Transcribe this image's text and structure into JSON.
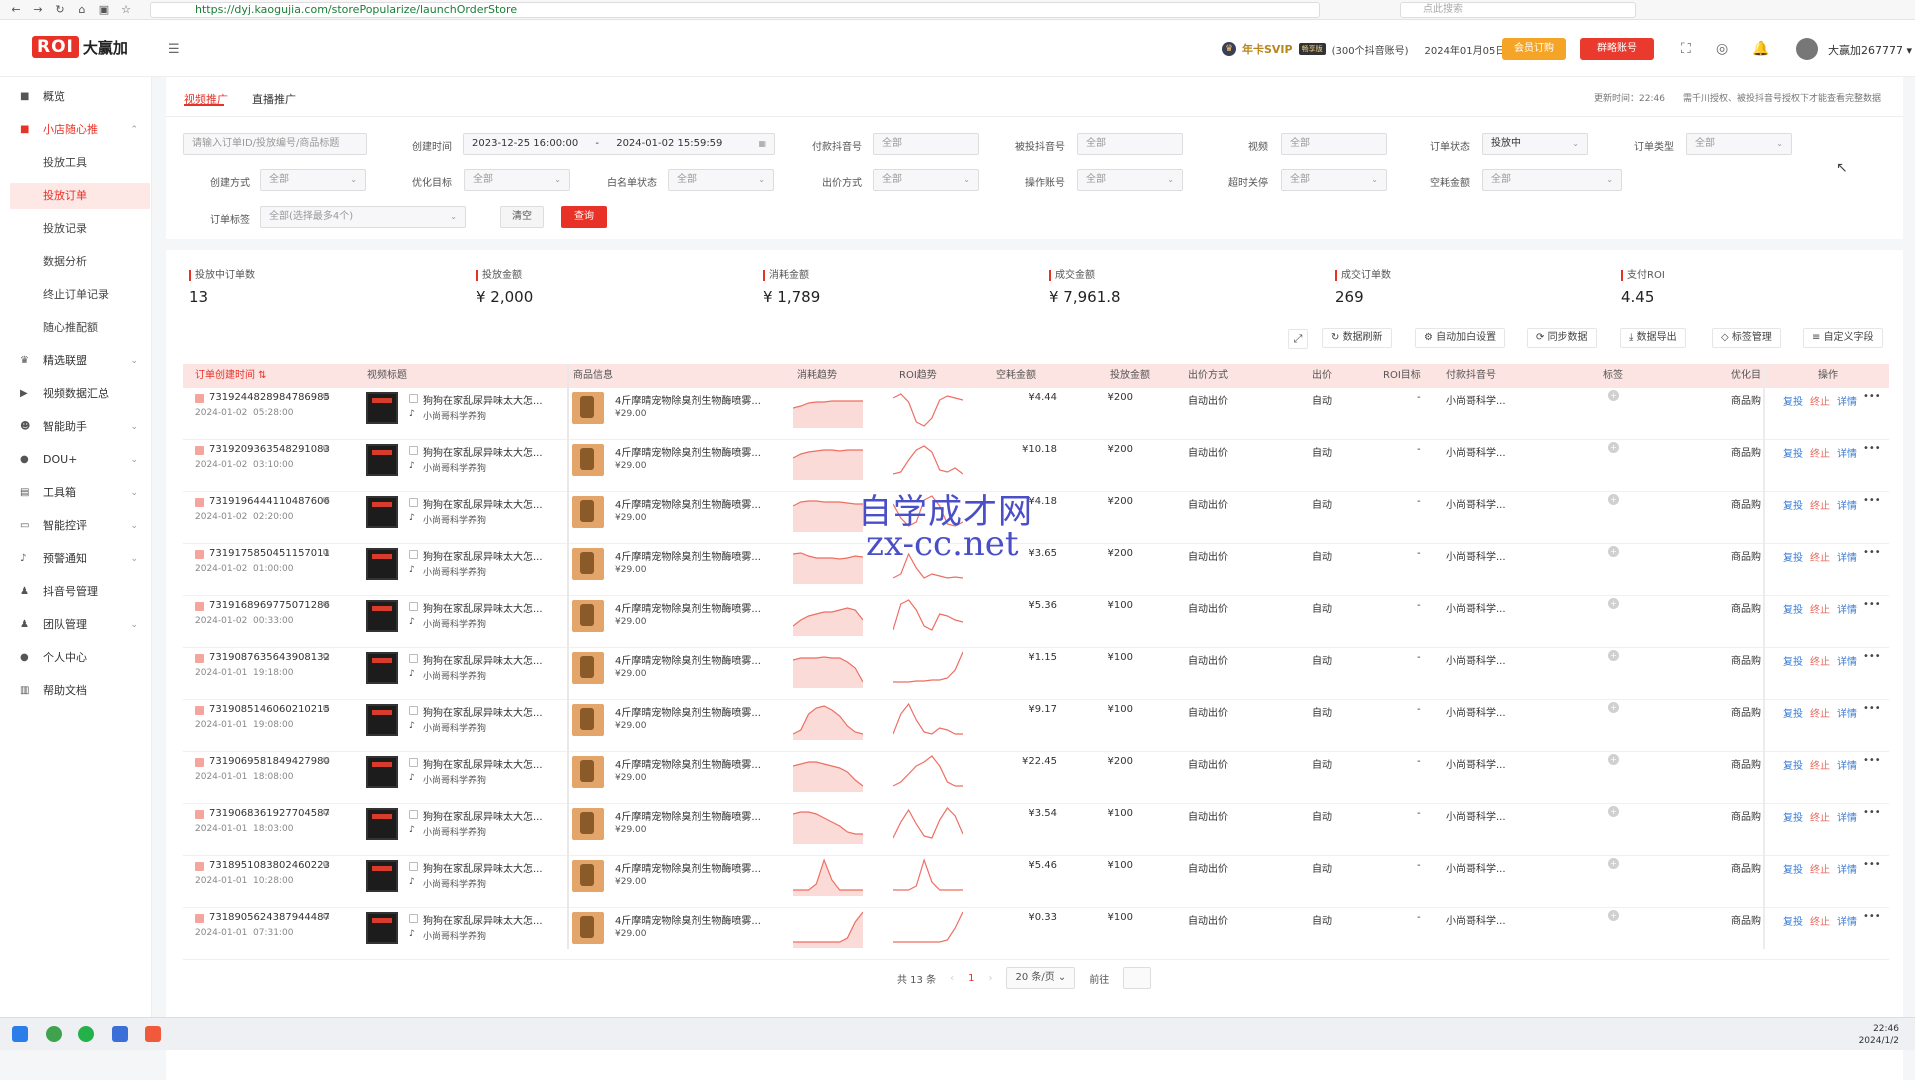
{
  "browser": {
    "url": "https://dyj.kaogujia.com/storePopularize/launchOrderStore",
    "search_placeholder": "点此搜索"
  },
  "header": {
    "logo_text": "ROI",
    "brand_name": "大赢加",
    "svip_label": "年卡SVIP",
    "svip_badge": "畅享版",
    "svip_accounts": "(300个抖音账号)",
    "expire": "2024年01月05日到期",
    "member_button": "会员订购",
    "bind_button": "群略账号",
    "username": "大赢加267777"
  },
  "sidebar": {
    "items": [
      {
        "label": "概览"
      },
      {
        "label": "小店随心推"
      },
      {
        "label": "投放工具"
      },
      {
        "label": "投放订单"
      },
      {
        "label": "投放记录"
      },
      {
        "label": "数据分析"
      },
      {
        "label": "终止订单记录"
      },
      {
        "label": "随心推配额"
      },
      {
        "label": "精选联盟"
      },
      {
        "label": "视频数据汇总"
      },
      {
        "label": "智能助手"
      },
      {
        "label": "DOU+"
      },
      {
        "label": "工具箱"
      },
      {
        "label": "智能控评"
      },
      {
        "label": "预警通知"
      },
      {
        "label": "抖音号管理"
      },
      {
        "label": "团队管理"
      },
      {
        "label": "个人中心"
      },
      {
        "label": "帮助文档"
      }
    ]
  },
  "tabs": [
    {
      "label": "视频推广"
    },
    {
      "label": "直播推广"
    }
  ],
  "update_note": "更新时间：22:46　　需千川授权、被投抖音号授权下才能查看完整数据",
  "filters": {
    "search_placeholder": "请输入订单ID/投放编号/商品标题",
    "created_time_label": "创建时间",
    "date_start": "2023-12-25 16:00:00",
    "date_sep": "-",
    "date_end": "2024-01-02 15:59:59",
    "pay_account_label": "付款抖音号",
    "target_account_label": "被投抖音号",
    "video_label": "视频",
    "order_status_label": "订单状态",
    "order_status_value": "投放中",
    "order_type_label": "订单类型",
    "create_method_label": "创建方式",
    "optimize_label": "优化目标",
    "whitelist_label": "白名单状态",
    "bid_label": "出价方式",
    "operator_label": "操作账号",
    "timeout_label": "超时关停",
    "empty_cost_label": "空耗金额",
    "order_tag_label": "订单标签",
    "tag_placeholder": "全部(选择最多4个)",
    "all": "全部",
    "clear_button": "清空",
    "query_button": "查询"
  },
  "stats": [
    {
      "label": "投放中订单数",
      "value": "13"
    },
    {
      "label": "投放金额",
      "value": "¥ 2,000"
    },
    {
      "label": "消耗金额",
      "value": "¥ 1,789"
    },
    {
      "label": "成交金额",
      "value": "¥ 7,961.8"
    },
    {
      "label": "成交订单数",
      "value": "269"
    },
    {
      "label": "支付ROI",
      "value": "4.45"
    }
  ],
  "toolbar": {
    "refresh": "数据刷新",
    "auto_whitelist": "自动加白设置",
    "sync": "同步数据",
    "export": "数据导出",
    "tag_manage": "标签管理",
    "custom_fields": "自定义字段"
  },
  "table": {
    "headers": [
      "订单创建时间",
      "视频标题",
      "商品信息",
      "消耗趋势",
      "ROI趋势",
      "空耗金额",
      "投放金额",
      "出价方式",
      "出价",
      "ROI目标",
      "付款抖音号",
      "标签",
      "优化目",
      "操作"
    ],
    "video_title": "狗狗在家乱尿异味太大怎...",
    "video_author": "小尚哥科学养狗",
    "product_title": "4斤摩晴宠物除臭剂生物酶喷雾...",
    "product_price": "¥29.00",
    "bid_method": "自动出价",
    "bid": "自动",
    "roi_target": "-",
    "pay_account": "小尚哥科学...",
    "optimize": "商品购",
    "ops": [
      "复投",
      "终止",
      "详情"
    ],
    "rows": [
      {
        "order_id": "7319244828984786985",
        "date": "2024-01-02",
        "time": "05:28:00",
        "empty_cost": "¥4.44",
        "amount": "¥200",
        "trend": [
          20,
          18,
          15,
          14,
          14,
          13,
          13,
          13,
          13,
          13
        ],
        "roi": [
          10,
          6,
          14,
          34,
          38,
          30,
          12,
          8,
          10,
          12
        ]
      },
      {
        "order_id": "7319209363548291083",
        "date": "2024-01-02",
        "time": "03:10:00",
        "empty_cost": "¥10.18",
        "amount": "¥200",
        "trend": [
          18,
          14,
          12,
          11,
          10,
          10,
          11,
          10,
          10,
          10
        ],
        "roi": [
          34,
          32,
          20,
          10,
          6,
          12,
          30,
          32,
          28,
          34
        ]
      },
      {
        "order_id": "7319196444110487606",
        "date": "2024-01-02",
        "time": "02:20:00",
        "empty_cost": "¥4.18",
        "amount": "¥200",
        "trend": [
          14,
          10,
          9,
          9,
          10,
          10,
          10,
          11,
          12,
          12
        ],
        "roi": [
          12,
          26,
          34,
          30,
          8,
          4,
          14,
          32,
          34,
          30
        ]
      },
      {
        "order_id": "7319175850451157011",
        "date": "2024-01-02",
        "time": "01:00:00",
        "empty_cost": "¥3.65",
        "amount": "¥200",
        "trend": [
          10,
          9,
          12,
          14,
          14,
          14,
          15,
          14,
          12,
          13
        ],
        "roi": [
          34,
          30,
          10,
          24,
          34,
          30,
          32,
          34,
          33,
          34
        ]
      },
      {
        "order_id": "7319168969775071286",
        "date": "2024-01-02",
        "time": "00:33:00",
        "empty_cost": "¥5.36",
        "amount": "¥100",
        "trend": [
          30,
          24,
          20,
          18,
          16,
          16,
          14,
          12,
          14,
          24
        ],
        "roi": [
          34,
          8,
          4,
          14,
          30,
          34,
          18,
          20,
          24,
          26
        ]
      },
      {
        "order_id": "7319087635643908132",
        "date": "2024-01-01",
        "time": "19:18:00",
        "empty_cost": "¥1.15",
        "amount": "¥100",
        "trend": [
          12,
          10,
          10,
          10,
          9,
          10,
          10,
          14,
          20,
          34
        ],
        "roi": [
          34,
          34,
          34,
          33,
          33,
          32,
          32,
          30,
          22,
          4
        ]
      },
      {
        "order_id": "7319085146060210215",
        "date": "2024-01-01",
        "time": "19:08:00",
        "empty_cost": "¥9.17",
        "amount": "¥100",
        "trend": [
          34,
          30,
          14,
          8,
          6,
          10,
          16,
          26,
          32,
          34
        ],
        "roi": [
          34,
          14,
          4,
          20,
          32,
          34,
          28,
          30,
          34,
          34
        ]
      },
      {
        "order_id": "7319069581849427980",
        "date": "2024-01-01",
        "time": "18:08:00",
        "empty_cost": "¥22.45",
        "amount": "¥200",
        "trend": [
          14,
          12,
          10,
          10,
          12,
          14,
          16,
          20,
          28,
          34
        ],
        "roi": [
          34,
          30,
          22,
          14,
          10,
          4,
          14,
          30,
          34,
          34
        ]
      },
      {
        "order_id": "7319068361927704587",
        "date": "2024-01-01",
        "time": "18:03:00",
        "empty_cost": "¥3.54",
        "amount": "¥100",
        "trend": [
          10,
          8,
          8,
          10,
          14,
          18,
          22,
          28,
          30,
          30
        ],
        "roi": [
          34,
          18,
          6,
          20,
          32,
          34,
          16,
          4,
          12,
          30
        ]
      },
      {
        "order_id": "7318951083802460223",
        "date": "2024-01-01",
        "time": "10:28:00",
        "empty_cost": "¥5.46",
        "amount": "¥100",
        "trend": [
          34,
          34,
          34,
          28,
          4,
          24,
          34,
          34,
          34,
          34
        ],
        "roi": [
          34,
          34,
          34,
          30,
          4,
          26,
          34,
          34,
          34,
          34
        ]
      },
      {
        "order_id": "7318905624387944487",
        "date": "2024-01-01",
        "time": "07:31:00",
        "empty_cost": "¥0.33",
        "amount": "¥100",
        "trend": [
          34,
          34,
          34,
          34,
          34,
          34,
          34,
          30,
          14,
          4
        ],
        "roi": [
          34,
          34,
          34,
          34,
          34,
          34,
          34,
          32,
          20,
          4
        ]
      }
    ]
  },
  "pager": {
    "total": "共 13 条",
    "page": "1",
    "per_page": "20 条/页",
    "goto": "前往"
  },
  "watermark": {
    "line1": "自学成才网",
    "line2": "zx-cc.net"
  },
  "clock": {
    "time": "22:46",
    "date": "2024/1/2"
  },
  "colors": {
    "accent": "#e83228",
    "link": "#3a7bd5",
    "warn": "#f4a527"
  }
}
